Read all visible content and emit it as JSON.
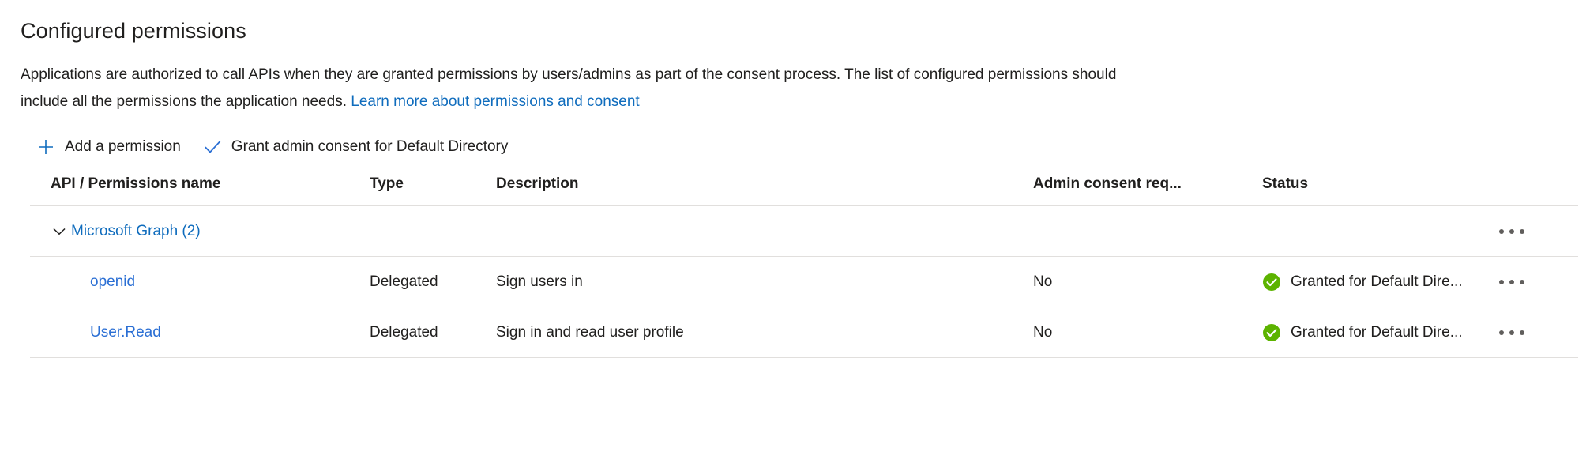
{
  "page": {
    "title": "Configured permissions"
  },
  "description": {
    "line1": "Applications are authorized to call APIs when they are granted permissions by users/admins as part of the consent process. The list of configured permissions should",
    "line2_prefix": "include all the permissions the application needs. ",
    "link_text": "Learn more about permissions and consent"
  },
  "toolbar": {
    "add_permission_label": "Add a permission",
    "add_permission_icon": "plus-icon",
    "grant_consent_label": "Grant admin consent for Default Directory",
    "grant_consent_icon": "checkmark-icon"
  },
  "table": {
    "headers": {
      "name": "API / Permissions name",
      "type": "Type",
      "description": "Description",
      "admin_consent": "Admin consent req...",
      "status": "Status",
      "menu": ""
    },
    "group": {
      "label": "Microsoft Graph (2)",
      "chevron_icon": "chevron-down-icon",
      "menu_icon": "more-options-icon"
    },
    "rows": [
      {
        "name": "openid",
        "type": "Delegated",
        "description": "Sign users in",
        "admin_consent": "No",
        "status": "Granted for Default Dire...",
        "status_icon": "granted-check-icon",
        "menu_icon": "more-options-icon"
      },
      {
        "name": "User.Read",
        "type": "Delegated",
        "description": "Sign in and read user profile",
        "admin_consent": "No",
        "status": "Granted for Default Dire...",
        "status_icon": "granted-check-icon",
        "menu_icon": "more-options-icon"
      }
    ]
  },
  "colors": {
    "link": "#0f6cbd",
    "accent": "#2b6fd4",
    "success": "#5cb300",
    "text": "#201f1e",
    "divider": "#e1dfdd"
  }
}
